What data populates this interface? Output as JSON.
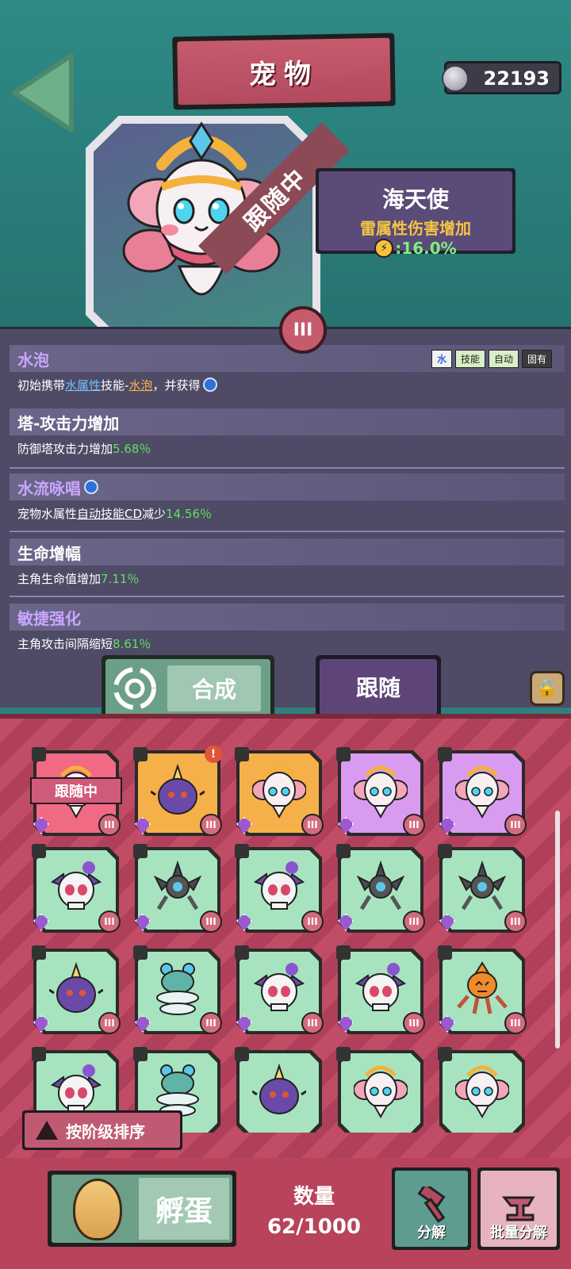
{
  "header": {
    "title": "宠物",
    "coins": "22193"
  },
  "pet": {
    "name": "海天使",
    "bonus_label": "雷属性伤害增加",
    "bonus_value": "16.0%",
    "status_ribbon": "跟随中",
    "menu_icon": "III"
  },
  "skills": [
    {
      "name": "水泡",
      "tags": [
        "水",
        "技能",
        "自动",
        "固有"
      ],
      "desc_prefix": "初始携带",
      "desc_link1": "水属性",
      "desc_mid": "技能-",
      "desc_link2": "水泡",
      "desc_suffix": "，并获得"
    },
    {
      "name": "塔-攻击力增加",
      "desc": "防御塔攻击力增加",
      "value": "5.68％"
    },
    {
      "name": "水流咏唱",
      "desc_prefix": "宠物水属性",
      "desc_link": "自动技能CD",
      "desc_suffix": "减少",
      "value": "14.56％"
    },
    {
      "name": "生命增幅",
      "desc": "主角生命值增加",
      "value": "7.11％"
    },
    {
      "name": "敏捷强化",
      "desc": "主角攻击间隔缩短",
      "value": "8.61％"
    }
  ],
  "tabs": {
    "synth": "合成",
    "follow": "跟随"
  },
  "inventory": {
    "follow_tag": "跟随中",
    "sub_icon": "III",
    "alert_icon": "!"
  },
  "sort_button": "按阶级排序",
  "bottom": {
    "hatch": "孵蛋",
    "qty_label": "数量",
    "qty_value": "62/1000",
    "dismantle": "分解",
    "batch_dismantle": "批量分解"
  },
  "colors": {
    "teal_bg": "#2e8a86",
    "panel": "#4f4a66",
    "inventory_bg": "#c04c66",
    "accent_green": "#5fe25f"
  }
}
